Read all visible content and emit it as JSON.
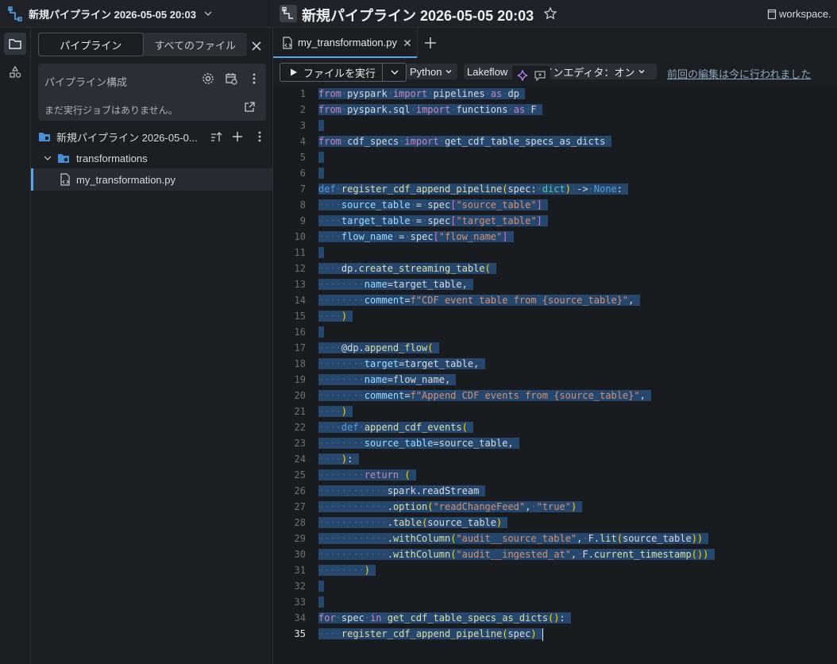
{
  "top_left": {
    "title": "新規パイプライン 2026-05-05 20:03"
  },
  "sidebar": {
    "tabs": [
      "パイプライン",
      "すべてのファイル"
    ],
    "config_title": "パイプライン構成",
    "config_message": "まだ実行ジョブはありません。",
    "tree": [
      {
        "label": "新規パイプライン 2026-05-0...",
        "icon": "folder-pipeline-icon"
      },
      {
        "label": "transformations",
        "icon": "folder-icon"
      },
      {
        "label": "my_transformation.py",
        "icon": "file-icon"
      }
    ]
  },
  "editor": {
    "title": "新規パイプライン 2026-05-05 20:03",
    "workspace": "workspace.",
    "tab_label": "my_transformation.py",
    "run_label": "ファイルを実行",
    "language": "Python",
    "mode_label": "Lakeflow パイプラインエディタ：オン",
    "mode_visible": "Lakeflow",
    "mode_tail": "インエディタ：オン",
    "last_edit": "前回の編集は今に行われました",
    "current_line": 35
  },
  "code_lines": [
    "from pyspark import pipelines as dp",
    "from pyspark.sql import functions as F",
    "",
    "from cdf_specs import get_cdf_table_specs_as_dicts",
    "",
    "",
    "def register_cdf_append_pipeline(spec: dict) -> None:",
    "    source_table = spec[\"source_table\"]",
    "    target_table = spec[\"target_table\"]",
    "    flow_name = spec[\"flow_name\"]",
    "",
    "    dp.create_streaming_table(",
    "        name=target_table,",
    "        comment=f\"CDF event table from {source_table}\",",
    "    )",
    "",
    "    @dp.append_flow(",
    "        target=target_table,",
    "        name=flow_name,",
    "        comment=f\"Append CDF events from {source_table}\",",
    "    )",
    "    def append_cdf_events(",
    "        source_table=source_table,",
    "    ):",
    "        return (",
    "            spark.readStream",
    "            .option(\"readChangeFeed\", \"true\")",
    "            .table(source_table)",
    "            .withColumn(\"audit__source_table\", F.lit(source_table))",
    "            .withColumn(\"audit__ingested_at\", F.current_timestamp())",
    "        )",
    "",
    "",
    "for spec in get_cdf_table_specs_as_dicts():",
    "    register_cdf_append_pipeline(spec)"
  ]
}
